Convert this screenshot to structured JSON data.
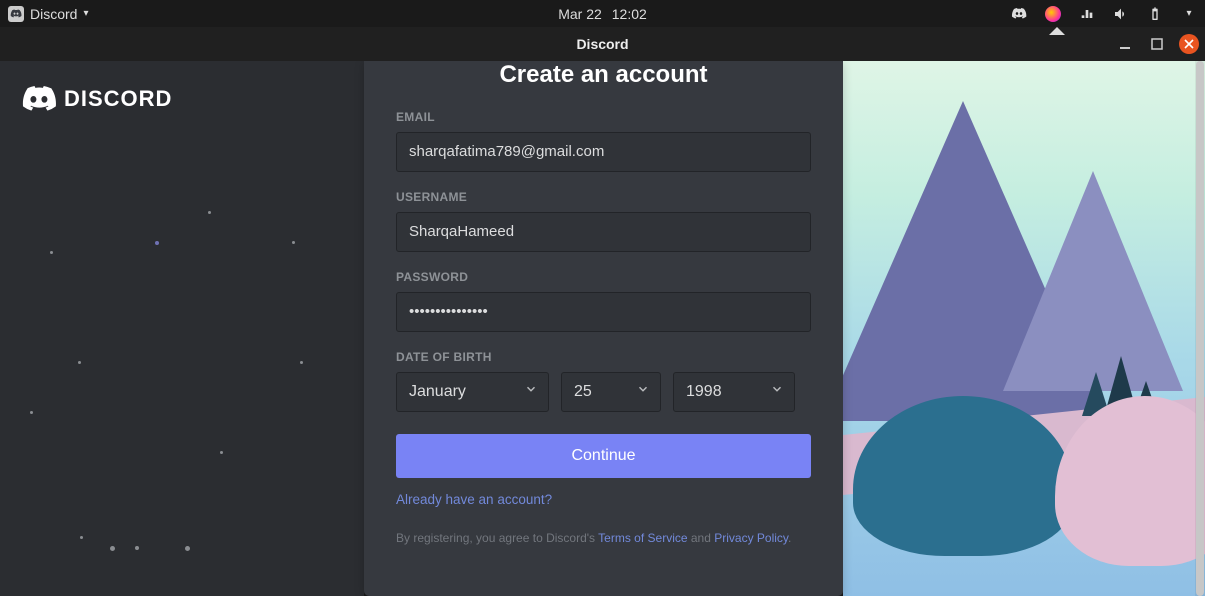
{
  "system_bar": {
    "app_name": "Discord",
    "date": "Mar 22",
    "time": "12:02"
  },
  "window": {
    "title": "Discord"
  },
  "brand": {
    "name": "DISCORD"
  },
  "signup": {
    "title": "Create an account",
    "email": {
      "label": "EMAIL",
      "value": "sharqafatima789@gmail.com"
    },
    "username": {
      "label": "USERNAME",
      "value": "SharqaHameed"
    },
    "password": {
      "label": "PASSWORD",
      "value": "•••••••••••••••"
    },
    "dob": {
      "label": "DATE OF BIRTH",
      "month": "January",
      "day": "25",
      "year": "1998"
    },
    "continue_label": "Continue",
    "login_link": "Already have an account?",
    "tos": {
      "prefix": "By registering, you agree to Discord's ",
      "terms": "Terms of Service",
      "and": " and ",
      "privacy": "Privacy Policy",
      "suffix": "."
    }
  }
}
